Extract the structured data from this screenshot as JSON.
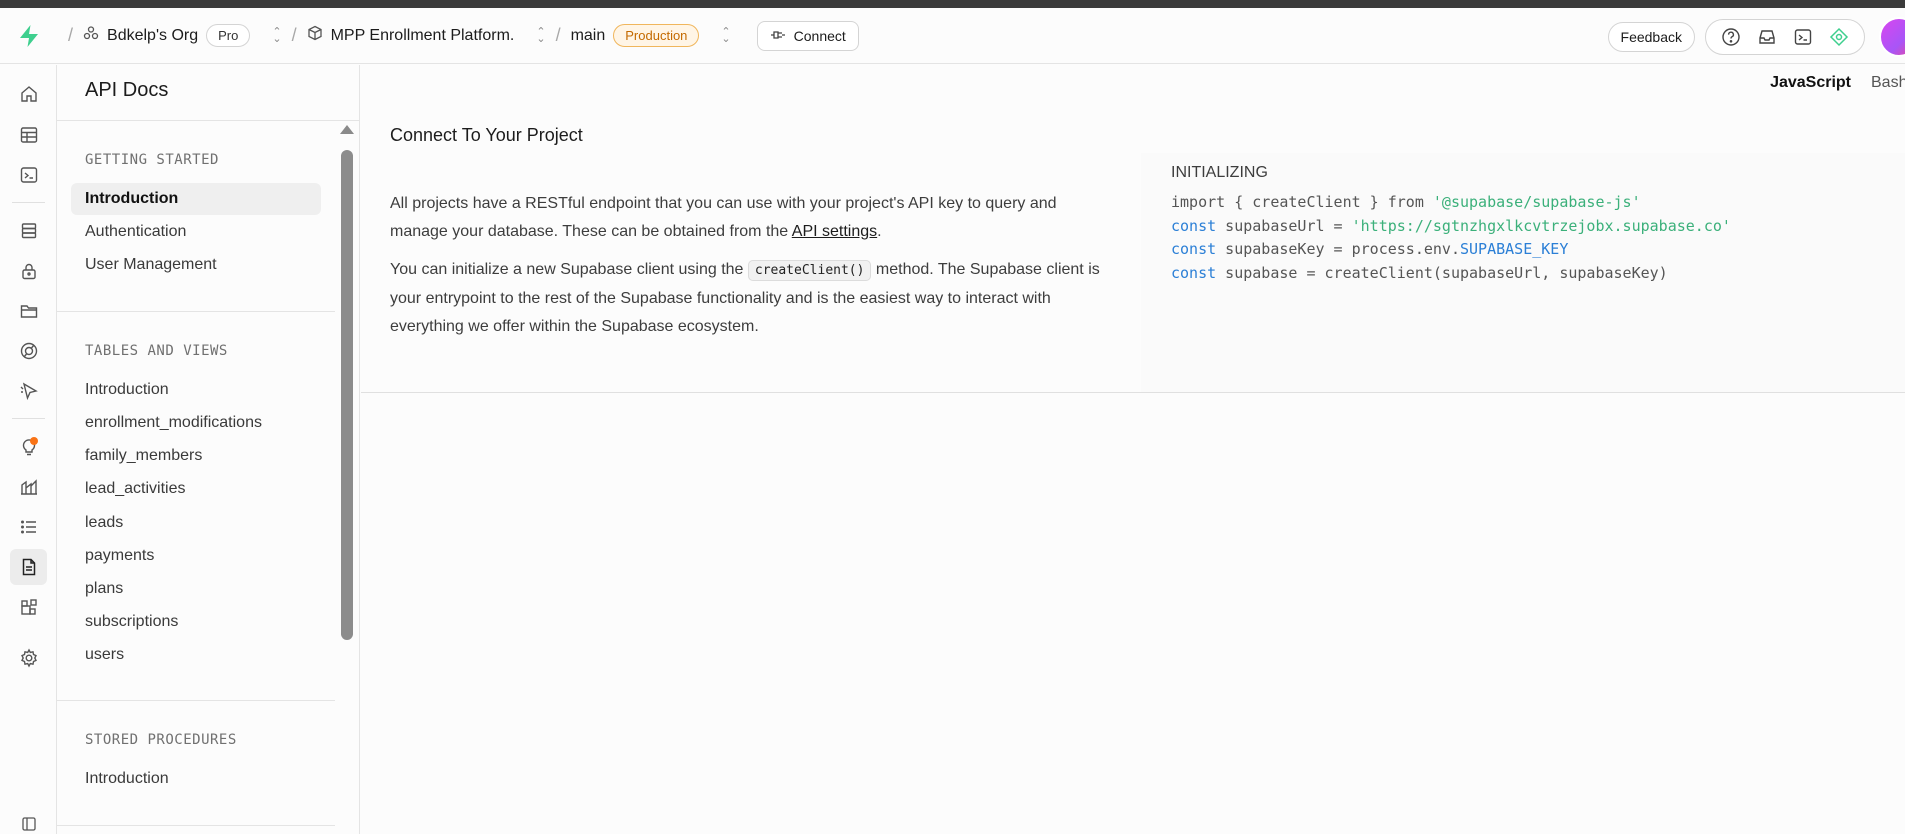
{
  "topbar": {
    "org_name": "Bdkelp's Org",
    "org_plan": "Pro",
    "project_name": "MPP Enrollment Platform.",
    "branch_name": "main",
    "branch_env": "Production",
    "connect_label": "Connect",
    "feedback_label": "Feedback",
    "separator": "/"
  },
  "sidebar": {
    "title": "API Docs",
    "sections": [
      {
        "heading": "GETTING STARTED",
        "items": [
          "Introduction",
          "Authentication",
          "User Management"
        ]
      },
      {
        "heading": "TABLES AND VIEWS",
        "items": [
          "Introduction",
          "enrollment_modifications",
          "family_members",
          "lead_activities",
          "leads",
          "payments",
          "plans",
          "subscriptions",
          "users"
        ]
      },
      {
        "heading": "STORED PROCEDURES",
        "items": [
          "Introduction"
        ]
      }
    ]
  },
  "main": {
    "lang_tabs": [
      "JavaScript",
      "Bash"
    ],
    "heading": "Connect To Your Project",
    "para1_a": "All projects have a RESTful endpoint that you can use with your project's API key to query and manage your database. These can be obtained from the ",
    "para1_link": "API settings",
    "para1_b": ".",
    "para2_a": "You can initialize a new Supabase client using the ",
    "para2_code": "createClient()",
    "para2_b": " method. The Supabase client is your entrypoint to the rest of the Supabase functionality and is the easiest way to interact with everything we offer within the Supabase ecosystem.",
    "code_title": "INITIALIZING",
    "code": {
      "l1_a": "import { createClient } from ",
      "l1_str": "'@supabase/supabase-js'",
      "kw_const": "const",
      "l2_a": " supabaseUrl = ",
      "l2_str": "'https://sgtnzhgxlkcvtrzejobx.supabase.co'",
      "l3_a": " supabaseKey = process.env.",
      "l3_env": "SUPABASE_KEY",
      "l4_a": " supabase = createClient(supabaseUrl, supabaseKey)"
    }
  },
  "colors": {
    "brand": "#3ecf8e",
    "production_badge": "#c46a00",
    "code_keyword": "#2b7fd6",
    "code_string": "#3bb07a",
    "notification_dot": "#f97316"
  }
}
